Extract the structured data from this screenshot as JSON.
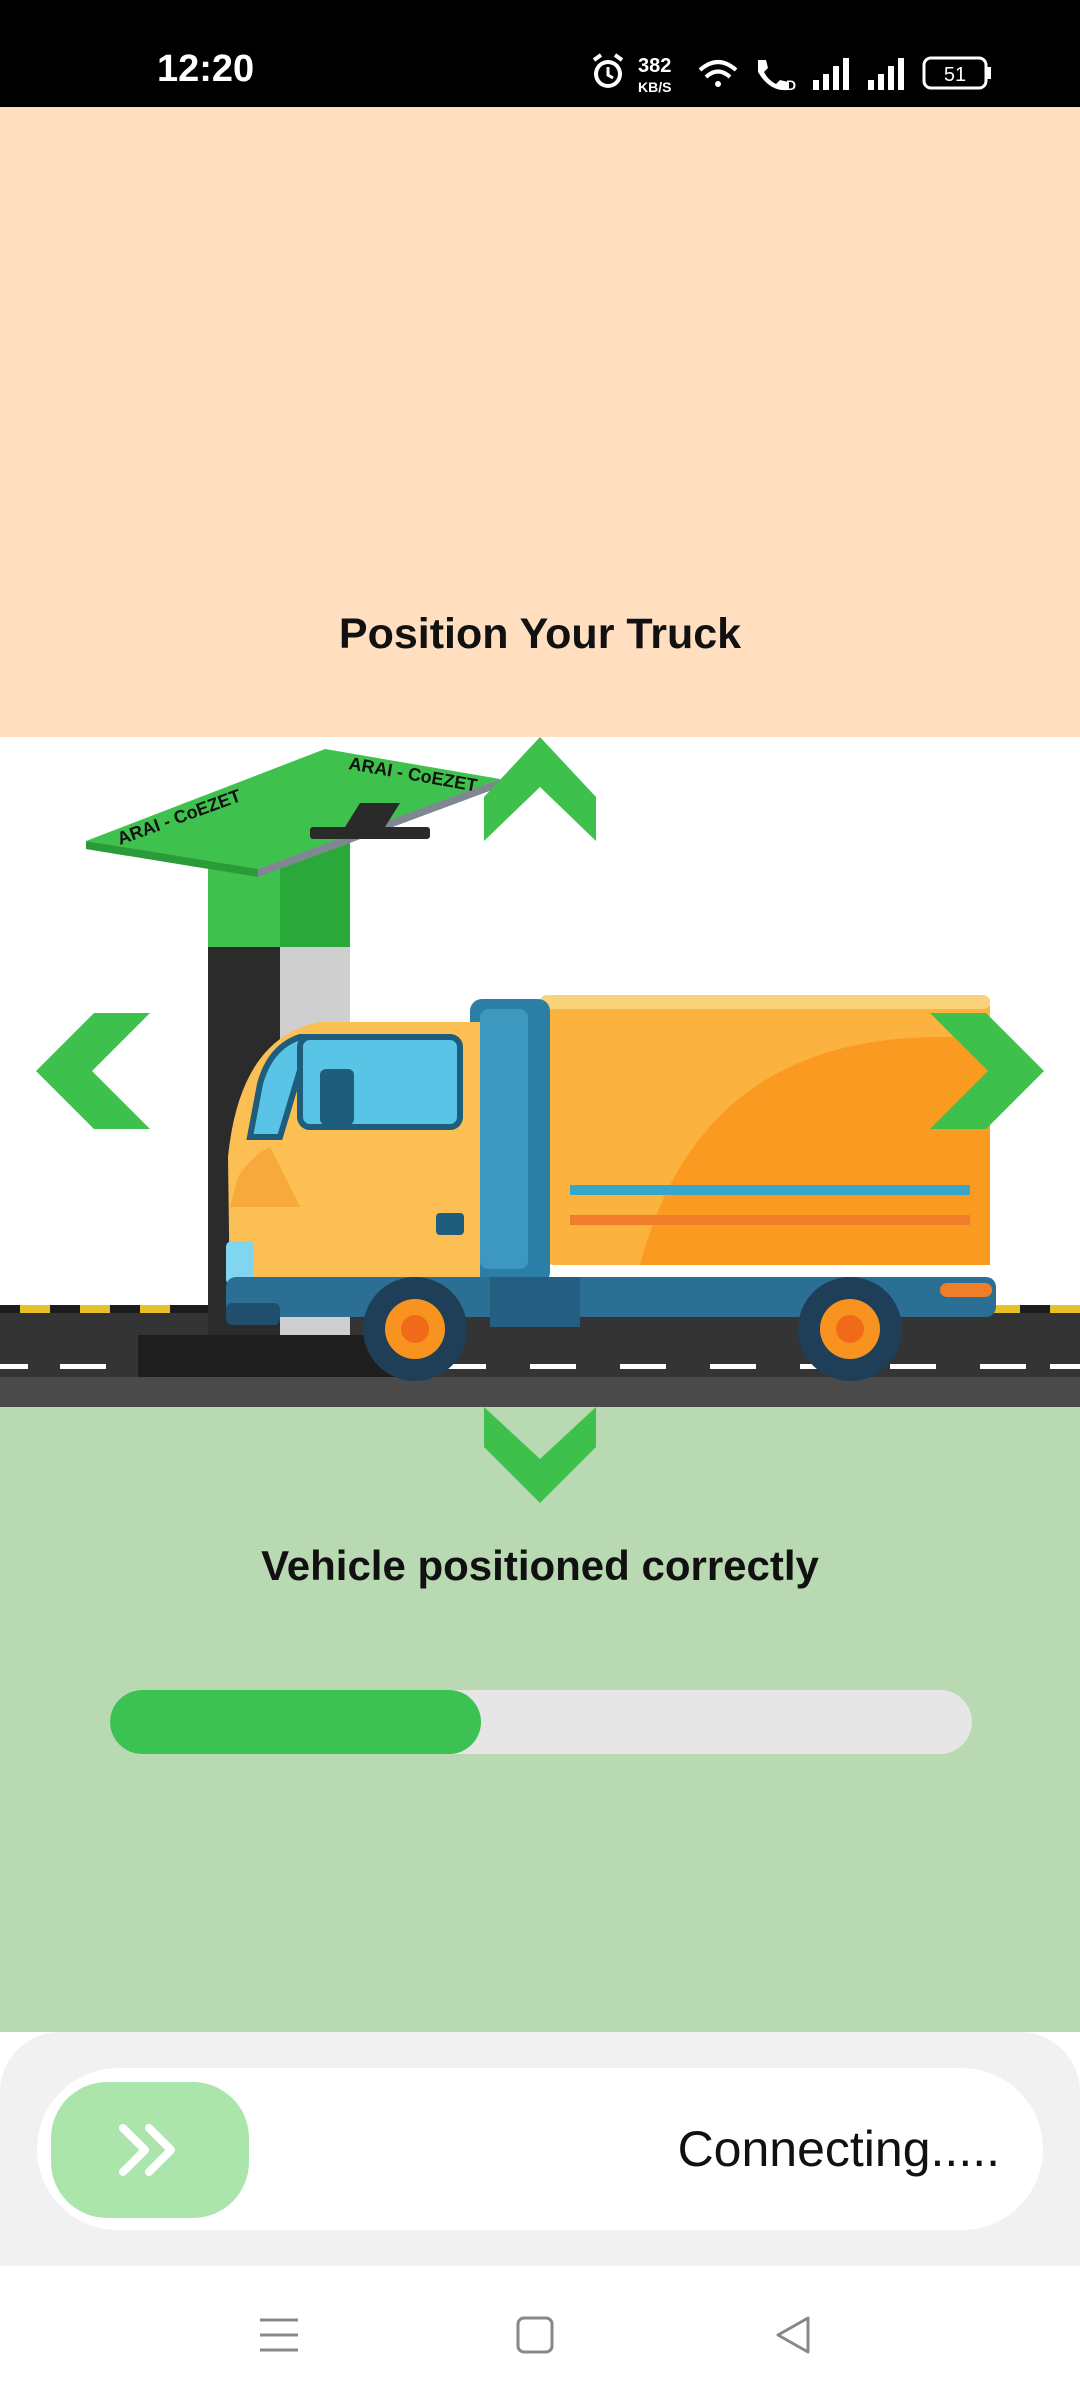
{
  "status_bar": {
    "time": "12:20",
    "net_speed_value": "382",
    "net_speed_unit": "KB/S",
    "battery": "51"
  },
  "header": {
    "title": "Position Your Truck"
  },
  "scene": {
    "station_brand_left": "ARAI - CoEZET",
    "station_brand_right": "ARAI - CoEZET",
    "colors": {
      "arrow": "#3ec04c",
      "truck_body": "#fbb23f",
      "truck_cab": "#fcbf53",
      "road": "#333333"
    }
  },
  "status": {
    "message": "Vehicle positioned correctly",
    "progress": 0.43
  },
  "swipe": {
    "label": "Connecting.....",
    "handle_icon": "double-chevron-right-icon"
  },
  "nav": {
    "menu_icon": "menu-icon",
    "home_icon": "home-square-icon",
    "back_icon": "back-triangle-icon"
  }
}
